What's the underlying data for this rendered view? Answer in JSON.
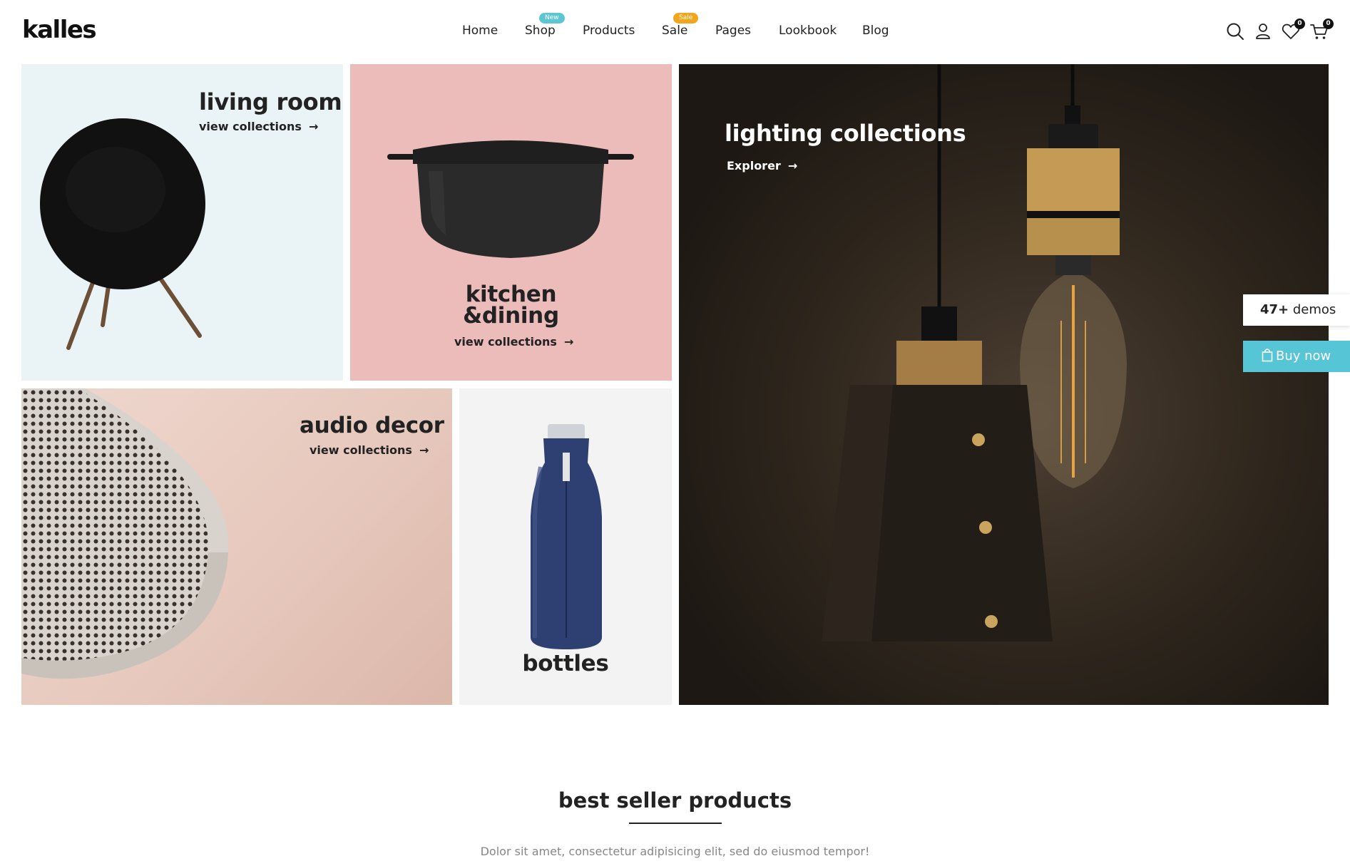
{
  "brand": {
    "logo": "kalles"
  },
  "nav": {
    "items": [
      {
        "label": "Home"
      },
      {
        "label": "Shop",
        "badge": "New"
      },
      {
        "label": "Products"
      },
      {
        "label": "Sale",
        "badge": "Sale"
      },
      {
        "label": "Pages"
      },
      {
        "label": "Lookbook"
      },
      {
        "label": "Blog"
      }
    ]
  },
  "header_icons": {
    "search": "search-icon",
    "account": "user-icon",
    "wishlist": {
      "icon": "heart-icon",
      "count": "0"
    },
    "cart": {
      "icon": "cart-icon",
      "count": "0"
    }
  },
  "tiles": {
    "living_room": {
      "title": "living room",
      "link": "view collections"
    },
    "kitchen": {
      "title_line1": "kitchen",
      "title_line2": "&dining",
      "link": "view collections"
    },
    "lighting": {
      "title": "lighting collections",
      "link": "Explorer"
    },
    "audio": {
      "title": "audio decor",
      "link": "view collections"
    },
    "bottles": {
      "title": "bottles"
    }
  },
  "side": {
    "demos_count": "47+",
    "demos_label": " demos",
    "buy_label": "Buy now"
  },
  "section": {
    "title": "best seller products",
    "subtitle": "Dolor sit amet, consectetur adipisicing elit, sed do eiusmod tempor!"
  },
  "colors": {
    "accent": "#56c5d5",
    "badge_new": "#5ec6d3",
    "badge_sale": "#f2a61c",
    "living_bg": "#eaf3f5",
    "kitchen_bg": "#ebbcb9",
    "bottles_bg": "#f3f3f4"
  }
}
